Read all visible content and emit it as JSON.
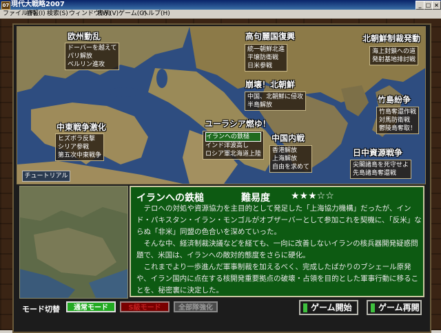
{
  "window": {
    "title": "現代大戦略2007",
    "icon_text": "07",
    "buttons": [
      "_",
      "□",
      "×"
    ]
  },
  "menu": [
    "ファイル(F)",
    "情報(I)",
    "検索(S)",
    "ウィンドウ(W)",
    "表示(V)",
    "ゲーム(G)",
    "ヘルプ(H)"
  ],
  "map": {
    "regions": [
      {
        "name": "欧州動乱",
        "items": [
          "ドーバーを越えて",
          "パリ解放",
          "ベルリン進攻"
        ]
      },
      {
        "name": "高句麗国復興",
        "items": [
          "統一朝鮮北進",
          "平壌防衛戦",
          "日米参戦"
        ]
      },
      {
        "name": "北朝鮮制裁発動",
        "items": [
          "海上封鎖への道",
          "発射基地排討戦"
        ]
      },
      {
        "name": "崩壊！北朝鮮",
        "items": [
          "中国、北朝鮮に侵攻",
          "半島解放"
        ]
      },
      {
        "name": "竹島紛争",
        "items": [
          "竹島奪還作戦",
          "対馬防衛戦",
          "鬱陵島奪取！"
        ]
      },
      {
        "name": "中東戦争激化",
        "items": [
          "ヒズボラ反撃",
          "シリア参戦",
          "第五次中東戦争"
        ]
      },
      {
        "name": "ユーラシア燃ゆ！",
        "items": [
          "イランへの鉄槌",
          "インド洋波高し",
          "ロシア軍北海道上陸"
        ]
      },
      {
        "name": "中国内戦",
        "items": [
          "香港解放",
          "上海解放",
          "自由を求めて"
        ]
      },
      {
        "name": "日中資源戦争",
        "items": [
          "尖閣諸島を死守せよ",
          "先島諸島奪還戦"
        ]
      }
    ],
    "tutorial_label": "チュートリアル",
    "colors": {
      "sea": "#2c4a7a",
      "land": "#8a7a4a"
    }
  },
  "scenario": {
    "title": "イランへの鉄槌",
    "difficulty_label": "難易度",
    "stars": "★★★☆☆",
    "difficulty": 3,
    "difficulty_max": 5,
    "paragraphs": [
      "　テロへの対処や資源協力を主目的として発足した「上海協力機構」だったが、インド・パキスタン・イラン・モンゴルがオブザーバーとして参加これを契機に、「反米」ならぬ「非米」同盟の色合いを深めていった。",
      "　そんな中、経済制裁決議などを経ても、一向に改善しないイランの核兵器開発疑惑問題で、米国は、イランへの敵対的態度をさらに硬化。",
      "　これまでより一歩進んだ軍事制裁を加えるべく、完成したばかりのブシェール原発や、イラン国内に点在する核開発重要拠点の破壊・占領を目的とした軍事行動に移ることを、秘密裏に決定した。"
    ]
  },
  "bottom": {
    "mode_label": "モード切替",
    "mode_normal": "通常モード",
    "mode_second": "S級モード",
    "mode_third": "全部隊強化",
    "start_label": "ゲーム開始",
    "resume_label": "ゲーム再開"
  }
}
